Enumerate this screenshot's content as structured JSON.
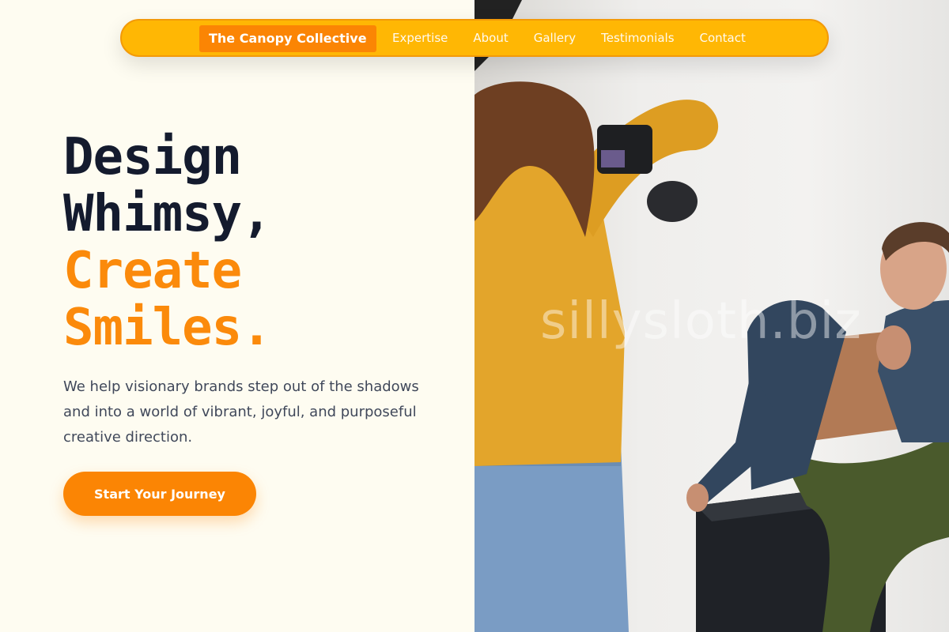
{
  "nav": {
    "brand": "The Canopy Collective",
    "links": [
      "Expertise",
      "About",
      "Gallery",
      "Testimonials",
      "Contact"
    ]
  },
  "hero": {
    "headline_dark": [
      "Design",
      "Whimsy,"
    ],
    "headline_accent": [
      "Create",
      "Smiles."
    ],
    "subtitle": "We help visionary brands step out of the shadows and into a world of vibrant, joyful, and purposeful creative direction.",
    "cta_label": "Start Your Journey"
  },
  "image": {
    "watermark": "sillysloth.biz",
    "description_icon": "photo-shoot-image"
  },
  "colors": {
    "background": "#fefcf1",
    "nav_bg": "#ffb704",
    "brand_bg": "#fb8504",
    "heading_dark": "#141b2e",
    "heading_accent": "#fb8a0b",
    "cta_bg": "#fb8504"
  }
}
